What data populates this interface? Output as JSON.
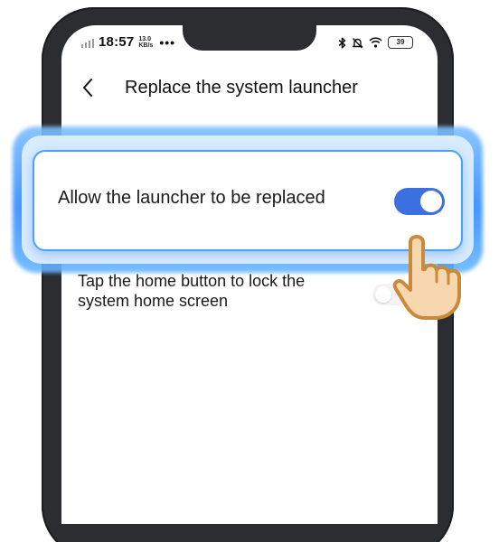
{
  "status_bar": {
    "time": "18:57",
    "net_speed_value": "13.0",
    "net_speed_unit": "KB/s",
    "more": "•••",
    "battery": "39",
    "icons": [
      "signal-icon",
      "bluetooth-icon",
      "mute-icon",
      "wifi-icon",
      "battery-icon"
    ]
  },
  "header": {
    "back_icon": "back-chevron-icon",
    "title": "Replace the system launcher"
  },
  "settings": [
    {
      "label": "Allow the launcher to be replaced",
      "enabled": true,
      "highlighted": true
    },
    {
      "label": "Tap the home button to lock the system home screen",
      "enabled": false,
      "highlighted": false
    }
  ],
  "colors": {
    "toggle_on": "#3c6fe0",
    "highlight_glow": "#2f8cff",
    "hand_skin": "#f6d7b0",
    "hand_outline": "#c98a3c"
  },
  "pointer": "tap-hand-icon"
}
